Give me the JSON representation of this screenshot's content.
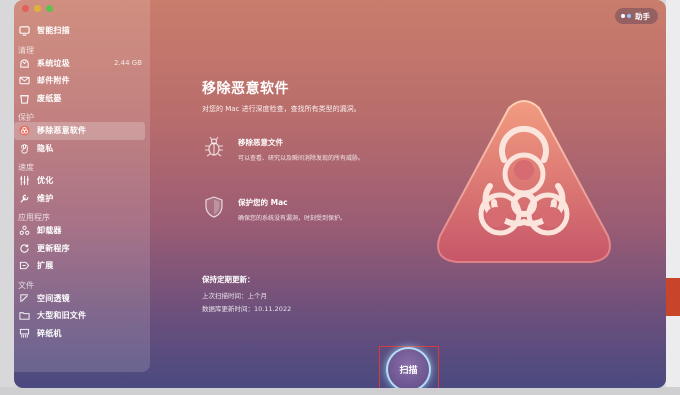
{
  "sidebar": {
    "top_item": {
      "label": "智能扫描",
      "icon": "monitor-icon"
    },
    "sections": [
      {
        "title": "清理",
        "items": [
          {
            "label": "系统垃圾",
            "value": "2.44 GB",
            "icon": "trash-can-icon"
          },
          {
            "label": "邮件附件",
            "icon": "envelope-icon"
          },
          {
            "label": "废纸篓",
            "icon": "bin-icon"
          }
        ]
      },
      {
        "title": "保护",
        "items": [
          {
            "label": "移除恶意软件",
            "icon": "biohazard-icon",
            "active": true
          },
          {
            "label": "隐私",
            "icon": "hand-icon"
          }
        ]
      },
      {
        "title": "速度",
        "items": [
          {
            "label": "优化",
            "icon": "sliders-icon"
          },
          {
            "label": "维护",
            "icon": "wrench-icon"
          }
        ]
      },
      {
        "title": "应用程序",
        "items": [
          {
            "label": "卸载器",
            "icon": "uninstaller-icon"
          },
          {
            "label": "更新程序",
            "icon": "update-icon"
          },
          {
            "label": "扩展",
            "icon": "extension-icon"
          }
        ]
      },
      {
        "title": "文件",
        "items": [
          {
            "label": "空间透镜",
            "icon": "lens-icon"
          },
          {
            "label": "大型和旧文件",
            "icon": "folder-icon"
          },
          {
            "label": "碎纸机",
            "icon": "shredder-icon"
          }
        ]
      }
    ]
  },
  "assistant": {
    "label": "助手"
  },
  "main": {
    "title": "移除恶意软件",
    "subtitle": "对您的 Mac 进行深度检查，查找所有类型的漏洞。",
    "features": [
      {
        "title": "移除恶意文件",
        "desc": "可以查看、研究以及瞬间消除发现的所有威胁。",
        "icon": "bug-icon"
      },
      {
        "title": "保护您的 Mac",
        "desc": "确保您的系统没有漏洞，时刻受到保护。",
        "icon": "shield-icon"
      }
    ],
    "schedule": {
      "title": "保持定期更新：",
      "last_scan": "上次扫描时间：上个月",
      "db_update": "数据库更新时间：10.11.2022"
    }
  },
  "scan_button": {
    "label": "扫描"
  },
  "colors": {
    "accent_red": "#e55f5a",
    "hazard_top": "#f09a7e",
    "hazard_bottom": "#c9596a"
  }
}
